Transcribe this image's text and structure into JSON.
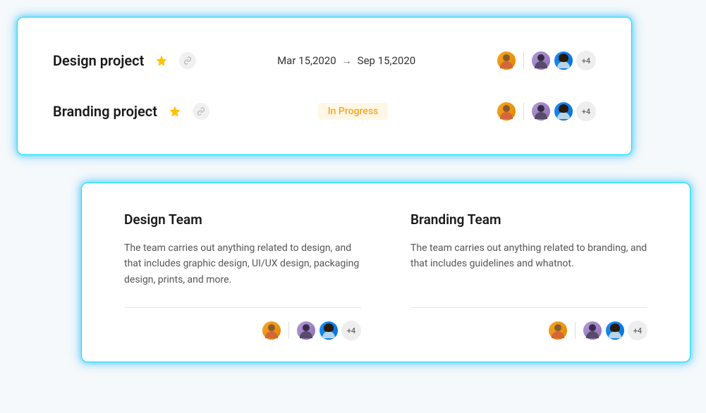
{
  "projects": [
    {
      "name": "Design project",
      "date_start": "Mar 15,2020",
      "date_end": "Sep 15,2020",
      "more_count": "+4"
    },
    {
      "name": "Branding project",
      "status": "In Progress",
      "more_count": "+4"
    }
  ],
  "teams": [
    {
      "title": "Design Team",
      "description": "The team carries out anything related to design, and that includes graphic design, UI/UX design, packaging design, prints, and more.",
      "more_count": "+4"
    },
    {
      "title": "Branding Team",
      "description": "The team carries out anything related to branding, and that includes guidelines and whatnot.",
      "more_count": "+4"
    }
  ]
}
